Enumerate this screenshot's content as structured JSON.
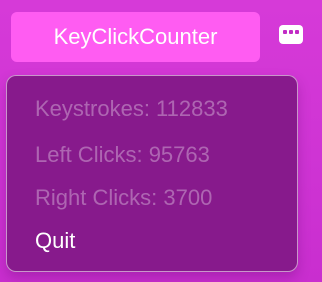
{
  "menubar": {
    "app_title": "KeyClickCounter",
    "status_icon": "keyboard-icon",
    "title_bg_color": "#ff5cf2"
  },
  "menu": {
    "items": [
      {
        "label": "Keystrokes: 112833",
        "enabled": false
      },
      {
        "label": "Left Clicks: 95763",
        "enabled": false
      },
      {
        "label": "Right Clicks: 3700",
        "enabled": false
      },
      {
        "label": "Quit",
        "enabled": true
      }
    ],
    "bg_color": "#871a8c"
  },
  "colors": {
    "desktop": "#d63ad8",
    "text": "#ffffff"
  }
}
